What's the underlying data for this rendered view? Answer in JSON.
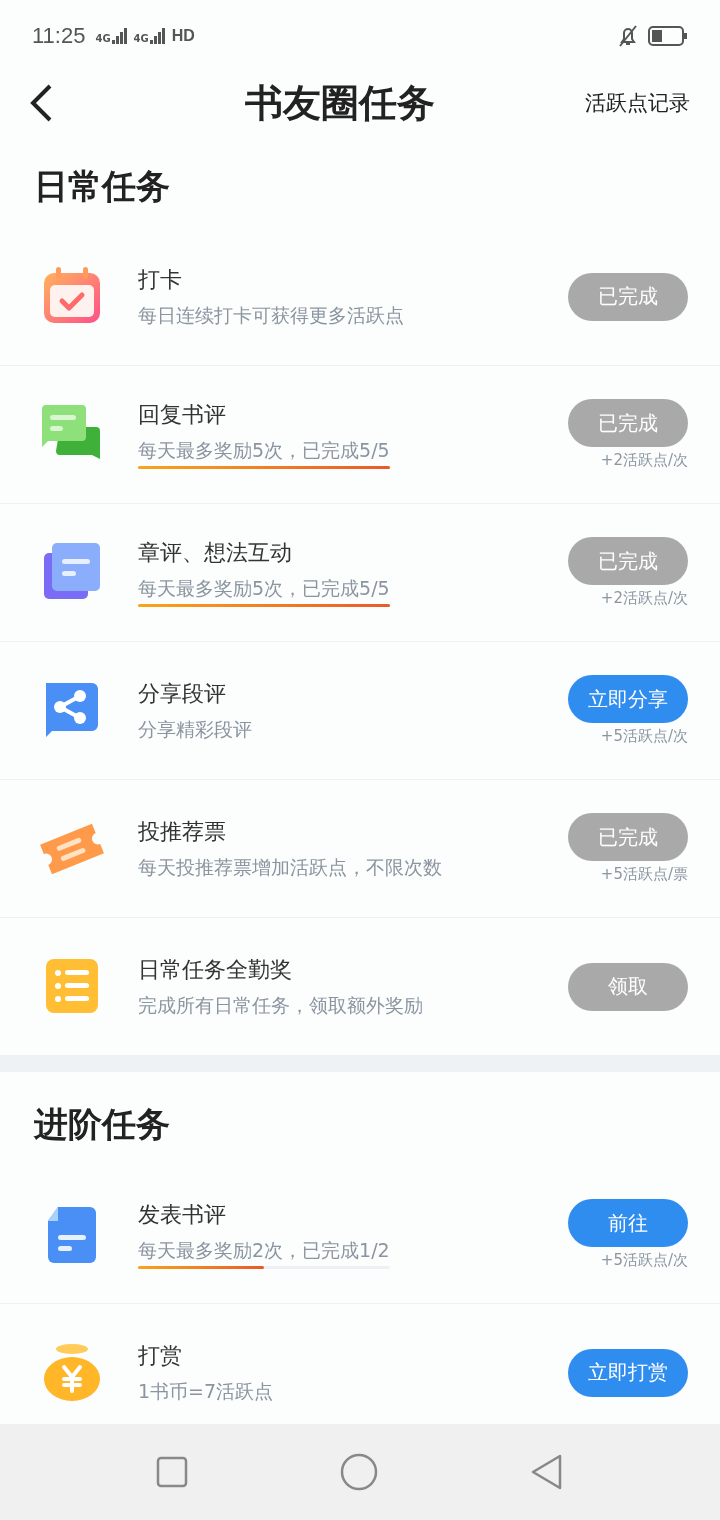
{
  "status_bar": {
    "time": "11:25",
    "networks": [
      "4G",
      "4G"
    ],
    "hd": "HD"
  },
  "header": {
    "title": "书友圈任务",
    "action": "活跃点记录"
  },
  "sections": [
    {
      "title": "日常任务",
      "tasks": [
        {
          "kind": "calendar",
          "title": "打卡",
          "desc": "每日连续打卡可获得更多活跃点",
          "button": {
            "label": "已完成",
            "enabled": false
          }
        },
        {
          "kind": "chat",
          "title": "回复书评",
          "desc": "每天最多奖励5次，已完成5/5",
          "level": 1,
          "button": {
            "label": "已完成",
            "enabled": false
          },
          "reward": "+2活跃点/次"
        },
        {
          "kind": "notes",
          "title": "章评、想法互动",
          "desc": "每天最多奖励5次，已完成5/5",
          "level": 1,
          "button": {
            "label": "已完成",
            "enabled": false
          },
          "reward": "+2活跃点/次"
        },
        {
          "kind": "share",
          "title": "分享段评",
          "desc": "分享精彩段评",
          "button": {
            "label": "立即分享",
            "enabled": true
          },
          "reward": "+5活跃点/次"
        },
        {
          "kind": "ticket",
          "title": "投推荐票",
          "desc": "每天投推荐票增加活跃点，不限次数",
          "button": {
            "label": "已完成",
            "enabled": false
          },
          "reward": "+5活跃点/票"
        },
        {
          "kind": "list",
          "title": "日常任务全勤奖",
          "desc": "完成所有日常任务，领取额外奖励",
          "button": {
            "label": "领取",
            "enabled": false
          }
        }
      ]
    },
    {
      "title": "进阶任务",
      "tasks": [
        {
          "kind": "document",
          "title": "发表书评",
          "desc": "每天最多奖励2次，已完成1/2",
          "level": 0.5,
          "button": {
            "label": "前往",
            "enabled": true
          },
          "reward": "+5活跃点/次"
        },
        {
          "kind": "moneybag",
          "title": "打赏",
          "desc": "1书币=7活跃点",
          "button": {
            "label": "立即打赏",
            "enabled": true
          }
        }
      ]
    }
  ]
}
